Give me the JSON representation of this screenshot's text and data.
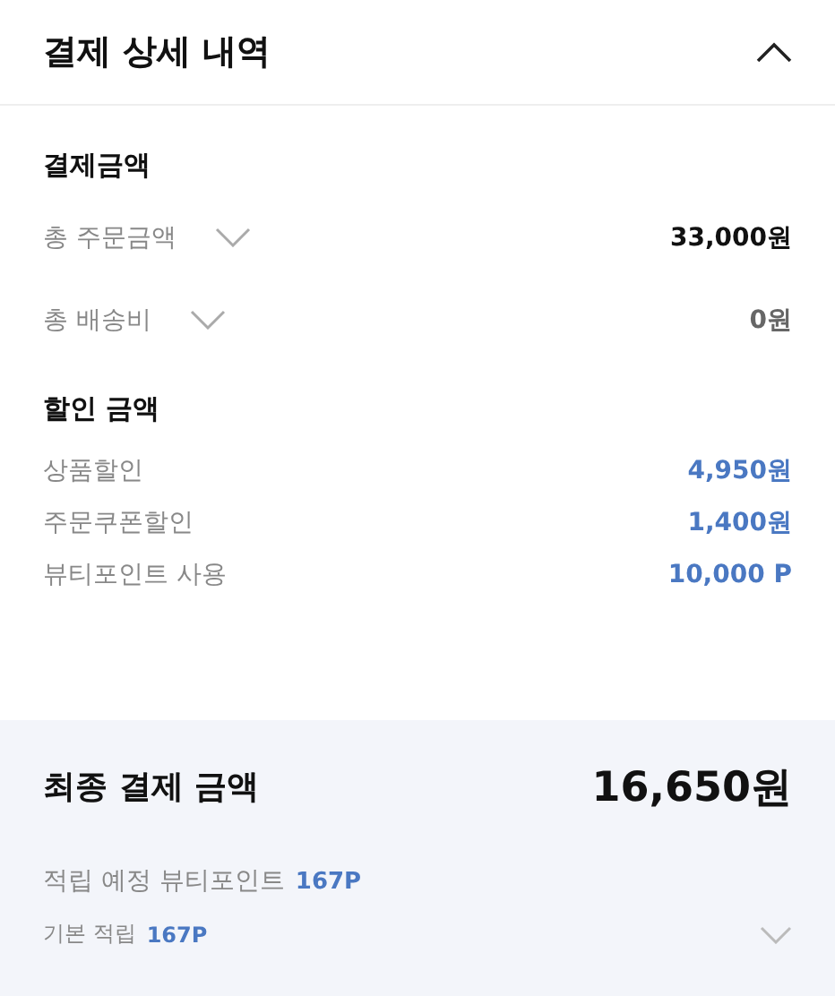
{
  "header": {
    "title": "결제 상세 내역",
    "expanded": true
  },
  "sections": [
    {
      "title": "결제금액",
      "rows": [
        {
          "label": "총 주문금액",
          "value": "33,000원",
          "kind": "amount",
          "expanded": false
        },
        {
          "label": "총 배송비",
          "value": "0원",
          "kind": "muted",
          "expanded": false
        }
      ]
    },
    {
      "title": "할인 금액",
      "rows": [
        {
          "label": "상품할인",
          "value": "4,950원",
          "kind": "discount"
        },
        {
          "label": "주문쿠폰할인",
          "value": "1,400원",
          "kind": "discount"
        },
        {
          "label": "뷰티포인트 사용",
          "value": "10,000 P",
          "kind": "discount"
        }
      ]
    }
  ],
  "total": {
    "label": "최종 결제 금액",
    "value": "16,650원"
  },
  "points": [
    {
      "label": "적립 예정 뷰티포인트",
      "value": "167P",
      "kind": "summary"
    },
    {
      "label": "기본 적립",
      "value": "167P",
      "kind": "detail",
      "expanded": false
    }
  ]
}
